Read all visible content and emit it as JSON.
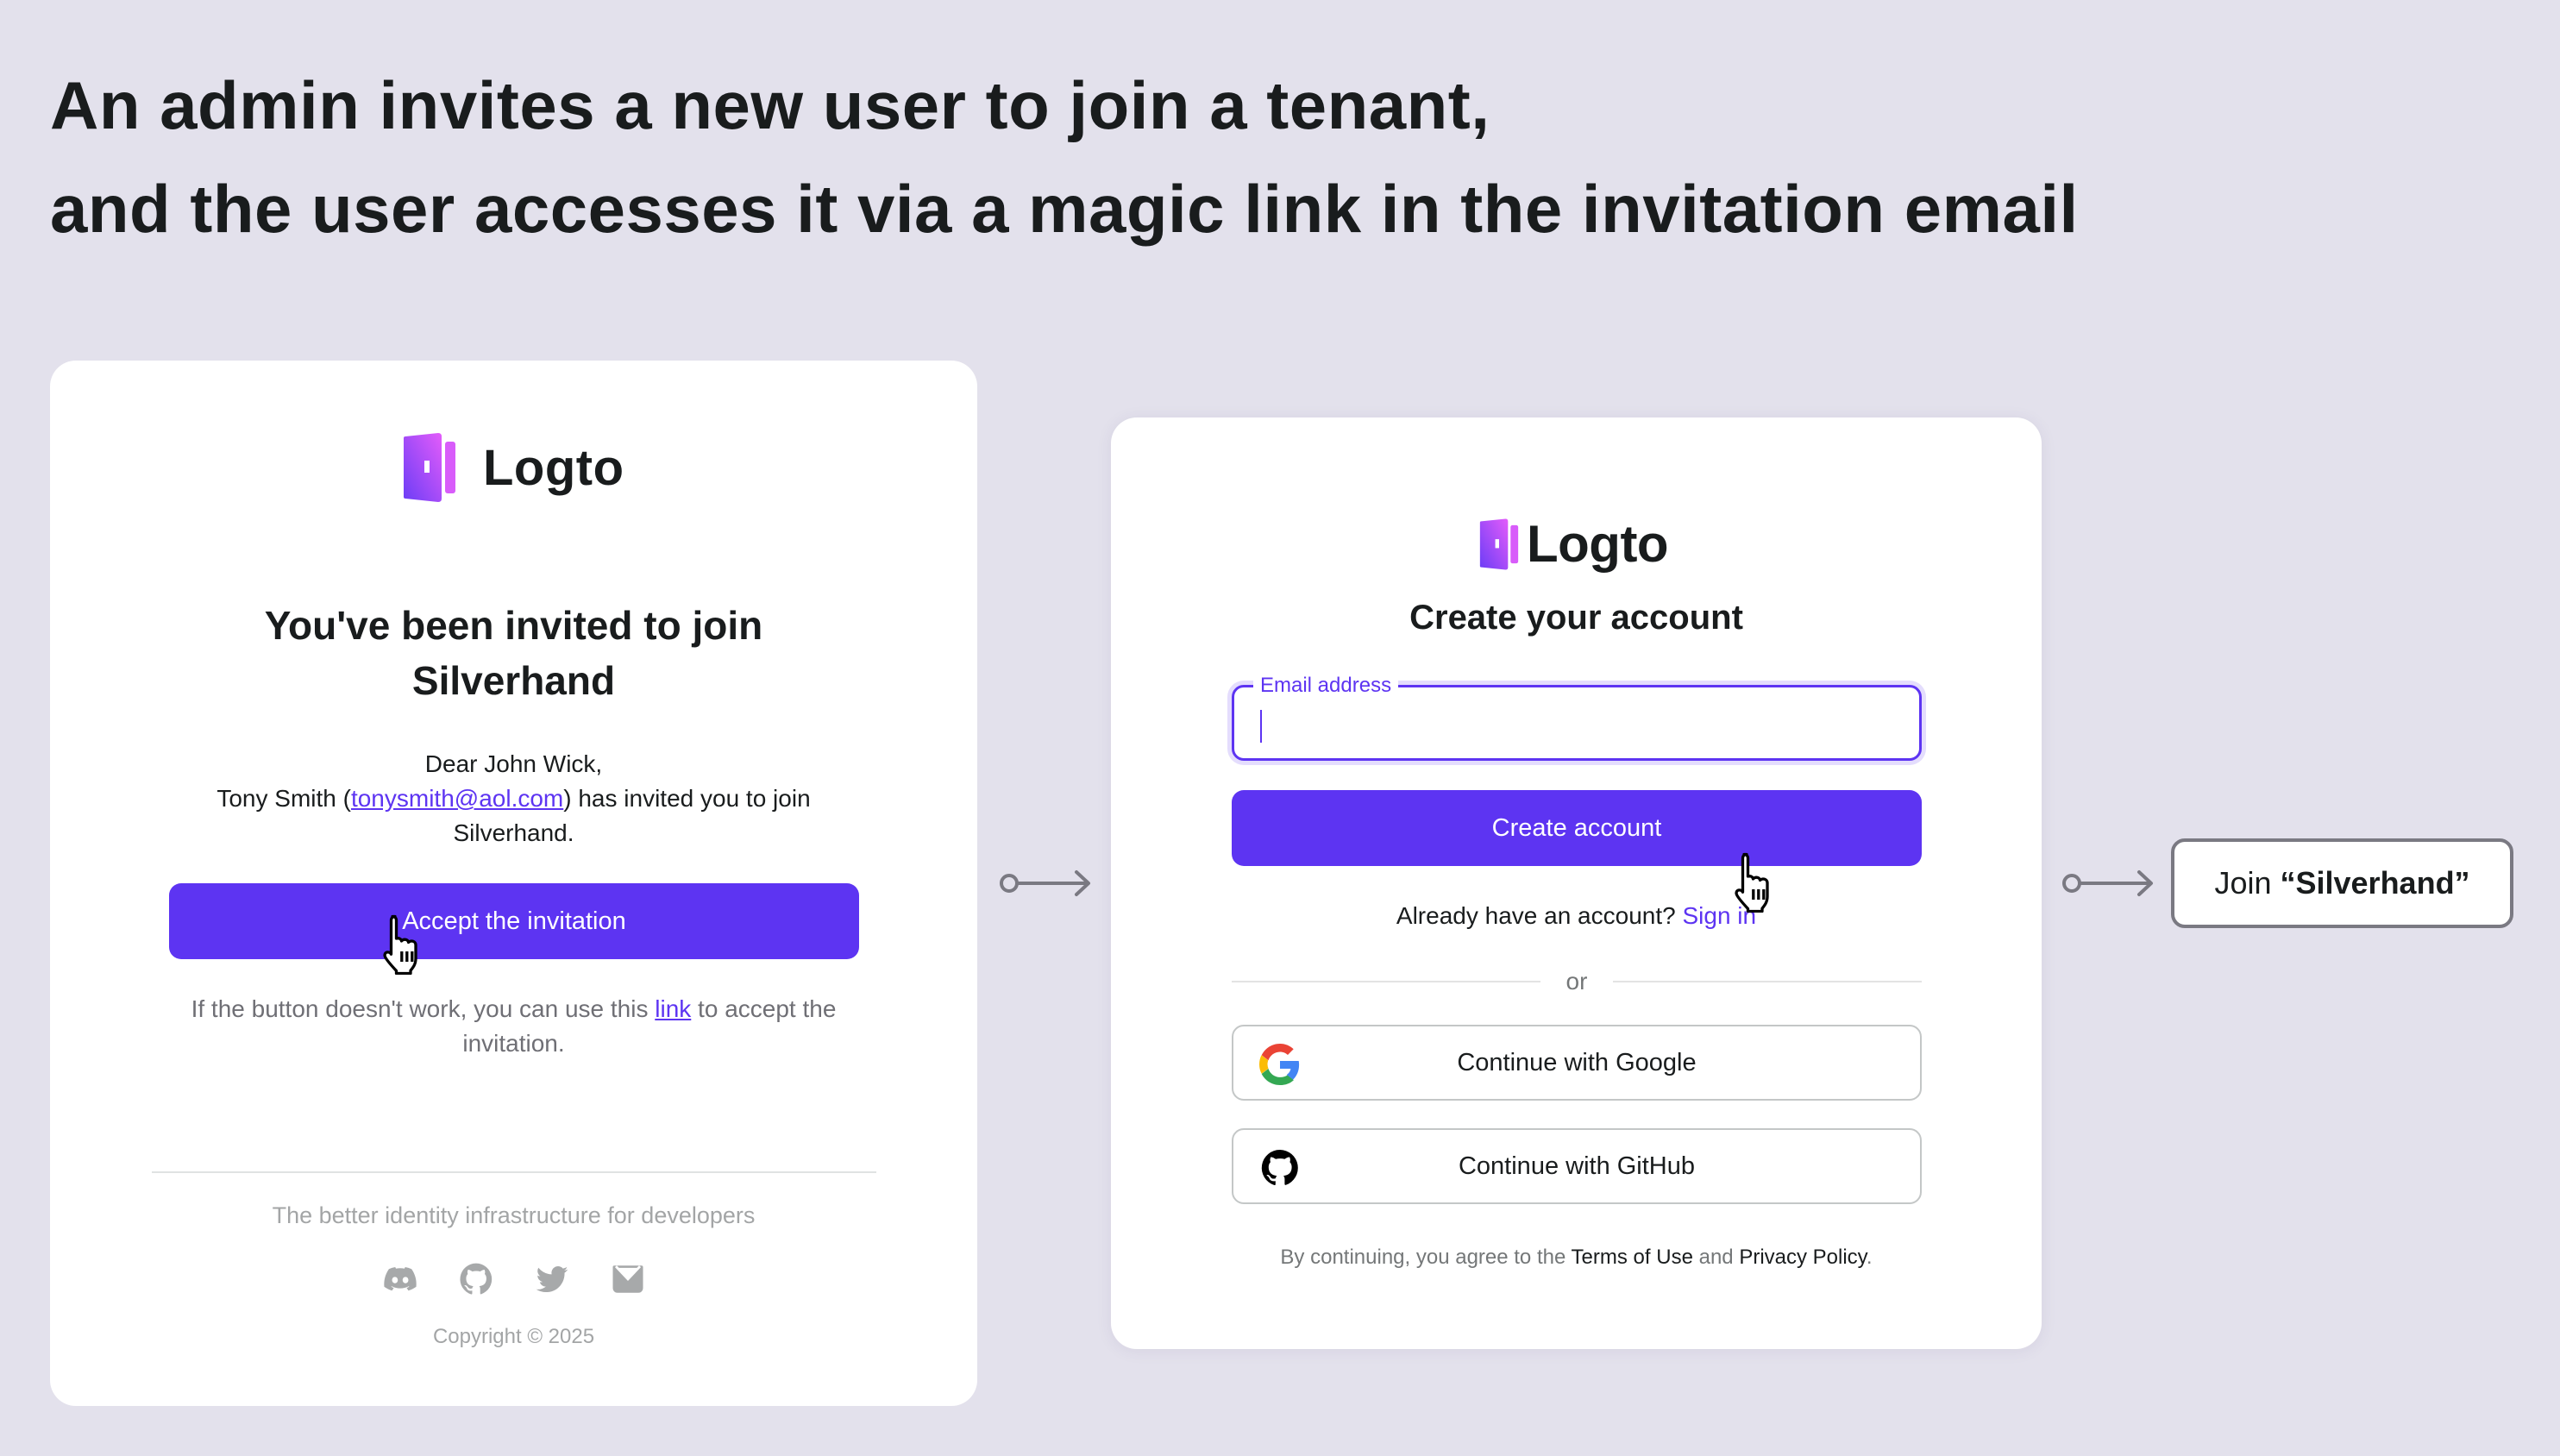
{
  "headline": {
    "line1": "An admin invites a new user to join a tenant,",
    "line2": "and the user accesses it via a magic link in the invitation email"
  },
  "brand": {
    "name": "Logto",
    "accent": "#5d34f2",
    "logo_gradient": [
      "#6b3df6",
      "#e35cfa"
    ]
  },
  "email_card": {
    "title": "You've been invited to join Silverhand",
    "greeting": "Dear John Wick,",
    "inviter_name": "Tony Smith",
    "inviter_open": " (",
    "inviter_email": "tonysmith@aol.com",
    "inviter_close": ") has invited you to join Silverhand.",
    "accept_button": "Accept the invitation",
    "fallback_prefix": "If the button doesn't work, you can use this ",
    "fallback_link": "link",
    "fallback_suffix": " to accept the invitation.",
    "tagline": "The better identity infrastructure for developers",
    "social_icons": [
      "discord-icon",
      "github-icon",
      "twitter-icon",
      "email-icon"
    ],
    "copyright": "Copyright © 2025"
  },
  "signup_card": {
    "title": "Create your account",
    "email_label": "Email address",
    "email_value": "",
    "create_button": "Create account",
    "signin_prompt": "Already have an account?",
    "signin_link": "Sign in",
    "divider_text": "or",
    "google_button": "Continue with Google",
    "github_button": "Continue with GitHub",
    "terms_prefix": "By continuing, you agree to the ",
    "terms_link": "Terms of Use",
    "terms_and": " and ",
    "privacy_link": "Privacy Policy",
    "terms_suffix": "."
  },
  "result": {
    "prefix": "Join ",
    "tenant": "“Silverhand”"
  }
}
